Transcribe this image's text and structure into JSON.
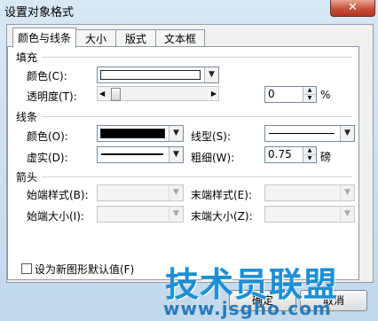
{
  "window": {
    "title": "设置对象格式",
    "close_glyph": "✕"
  },
  "tabs": [
    {
      "label": "颜色与线条",
      "active": true
    },
    {
      "label": "大小",
      "active": false
    },
    {
      "label": "版式",
      "active": false
    },
    {
      "label": "文本框",
      "active": false
    }
  ],
  "fill": {
    "section_label": "填充",
    "color_label": "颜色(C):",
    "color_value": "#ffffff",
    "transparency_label": "透明度(T):",
    "transparency_value": "0",
    "transparency_unit": "%",
    "transparency_fraction": 0
  },
  "line": {
    "section_label": "线条",
    "color_label": "颜色(O):",
    "color_value": "#000000",
    "style_label": "线型(S):",
    "dash_label": "虚实(D):",
    "weight_label": "粗细(W):",
    "weight_value": "0.75",
    "weight_unit": "磅"
  },
  "arrows": {
    "section_label": "箭头",
    "begin_style_label": "始端样式(B):",
    "end_style_label": "末端样式(E):",
    "begin_size_label": "始端大小(I):",
    "end_size_label": "末端大小(Z):"
  },
  "default_checkbox": {
    "label": "设为新图形默认值(F)",
    "checked": false
  },
  "buttons": {
    "ok": "确定",
    "cancel": "取消"
  },
  "watermark": {
    "logo_text": "技术员联盟",
    "url": "www.jsgho.com"
  }
}
